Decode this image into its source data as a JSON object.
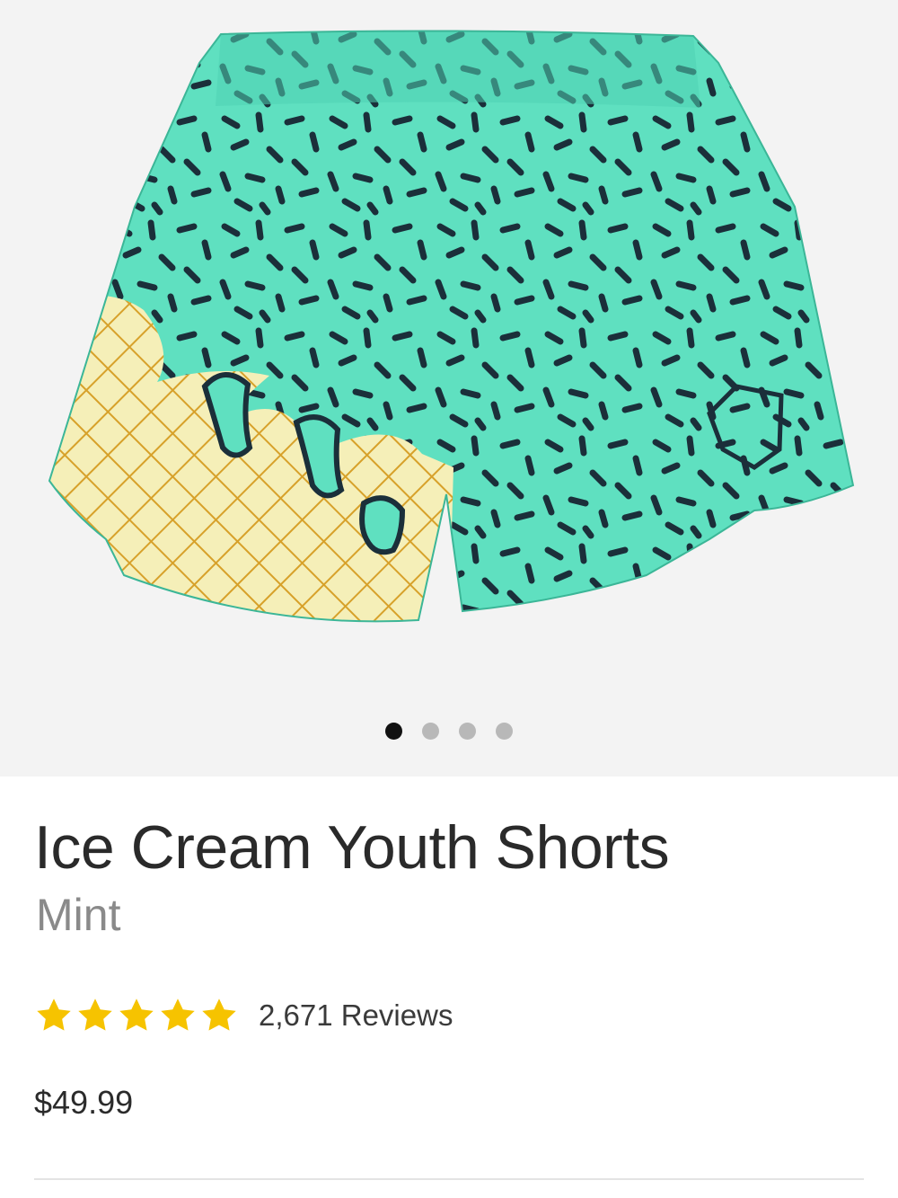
{
  "product": {
    "title": "Ice Cream Youth Shorts",
    "color": "Mint",
    "rating": 5,
    "rating_max": 5,
    "reviews": "2,671 Reviews",
    "price": "$49.99"
  },
  "gallery": {
    "image_count": 4,
    "active_index": 0
  },
  "colors": {
    "mint": "#5fe0c0",
    "cone": "#f5efb8",
    "cone_grid": "#d7a12a",
    "sprinkle": "#1b2f3a",
    "star": "#f6c300",
    "dot_active": "#111111",
    "dot_inactive": "#b8b8b8"
  }
}
